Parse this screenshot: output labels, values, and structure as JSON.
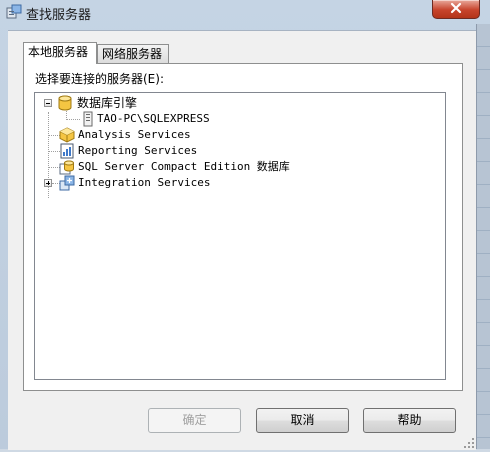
{
  "window": {
    "title": "查找服务器"
  },
  "tabs": [
    {
      "label": "本地服务器",
      "active": true
    },
    {
      "label": "网络服务器",
      "active": false
    }
  ],
  "panel": {
    "prompt": "选择要连接的服务器(E):"
  },
  "tree": {
    "root": {
      "label": "数据库引擎",
      "icon": "database-cylinder-icon",
      "expanded": true
    },
    "child": {
      "label": "TAO-PC\\SQLEXPRESS",
      "icon": "server-instance-icon"
    },
    "analysis": {
      "label": "Analysis Services",
      "icon": "analysis-cube-icon"
    },
    "reporting": {
      "label": "Reporting Services",
      "icon": "report-icon"
    },
    "compact": {
      "label": "SQL Server Compact Edition 数据库",
      "icon": "compact-db-icon"
    },
    "integration": {
      "label": "Integration Services",
      "icon": "integration-package-icon",
      "expanded": false
    }
  },
  "buttons": {
    "ok": {
      "label": "确定",
      "enabled": false
    },
    "cancel": {
      "label": "取消"
    },
    "help": {
      "label": "帮助"
    }
  },
  "colors": {
    "title_bar": "#c5d4e4",
    "close_button": "#c7442c",
    "dialog_bg": "#f0f0f0",
    "database_icon": "#f5c542"
  }
}
